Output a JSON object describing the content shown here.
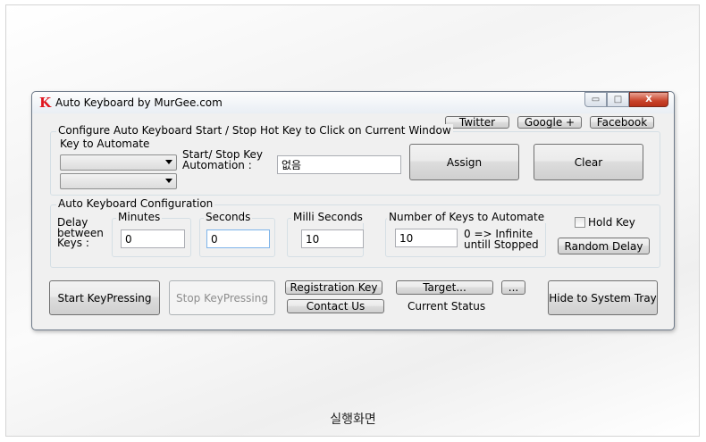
{
  "caption": "실행화면",
  "window": {
    "icon_letter": "K",
    "title": "Auto Keyboard by MurGee.com",
    "controls": {
      "minimize": "▭",
      "maximize": "□",
      "close": "X"
    }
  },
  "links": {
    "twitter": "Twitter",
    "google": "Google +",
    "facebook": "Facebook"
  },
  "hotkey_group": {
    "title": "Configure Auto Keyboard Start / Stop Hot Key to Click on Current Window",
    "key_to_automate": "Key to Automate",
    "start_stop_label_1": "Start/ Stop Key",
    "start_stop_label_2": "Automation :",
    "hotkey_value": "없음",
    "assign": "Assign",
    "clear": "Clear"
  },
  "config_group": {
    "title": "Auto Keyboard Configuration",
    "delay_line1": "Delay",
    "delay_line2": "between",
    "delay_line3": "Keys :",
    "minutes_label": "Minutes",
    "minutes_value": "0",
    "seconds_label": "Seconds",
    "seconds_value": "0",
    "milli_label": "Milli Seconds",
    "milli_value": "10",
    "num_keys_label": "Number of Keys to Automate",
    "num_keys_value": "10",
    "infinite_line1": "0 => Infinite",
    "infinite_line2": "untill Stopped",
    "hold_key": "Hold Key",
    "hold_key_checked": false,
    "random_delay": "Random Delay"
  },
  "bottom": {
    "start": "Start KeyPressing",
    "stop": "Stop KeyPressing",
    "registration": "Registration Key",
    "contact": "Contact Us",
    "target": "Target...",
    "more": "...",
    "status": "Current Status",
    "hide": "Hide to System Tray"
  }
}
